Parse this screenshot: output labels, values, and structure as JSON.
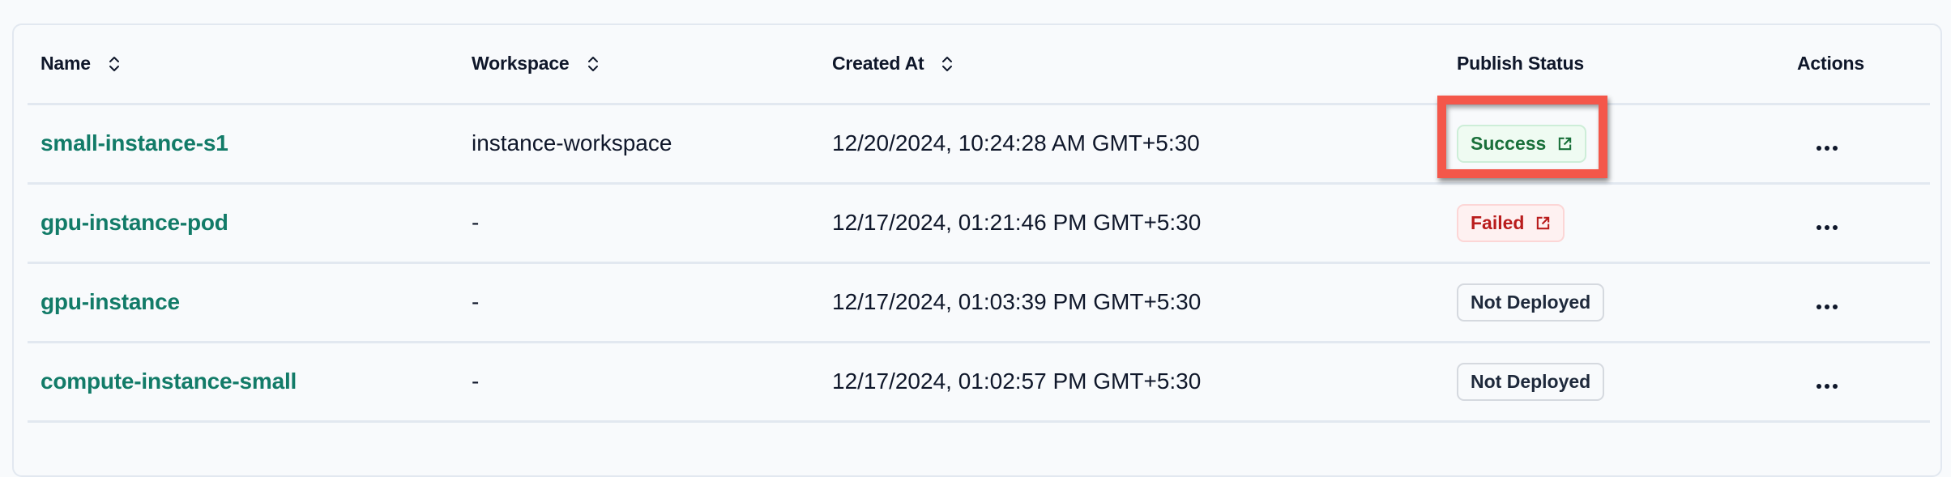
{
  "table": {
    "columns": [
      {
        "label": "Name",
        "sortable": true,
        "sort_icon": "sort-updown-icon"
      },
      {
        "label": "Workspace",
        "sortable": true,
        "sort_icon": "sort-updown-icon"
      },
      {
        "label": "Created At",
        "sortable": true,
        "sort_icon": "sort-updown-icon"
      },
      {
        "label": "Publish Status",
        "sortable": false
      },
      {
        "label": "Actions",
        "sortable": false
      }
    ],
    "rows": [
      {
        "name": "small-instance-s1",
        "workspace": "instance-workspace",
        "created_at": "12/20/2024, 10:24:28 AM GMT+5:30",
        "status": "Success",
        "status_type": "success",
        "status_icon": "external-link-icon",
        "actions_icon": "more-horizontal-icon"
      },
      {
        "name": "gpu-instance-pod",
        "workspace": "-",
        "created_at": "12/17/2024, 01:21:46 PM GMT+5:30",
        "status": "Failed",
        "status_type": "failed",
        "status_icon": "external-link-icon",
        "actions_icon": "more-horizontal-icon"
      },
      {
        "name": "gpu-instance",
        "workspace": "-",
        "created_at": "12/17/2024, 01:03:39 PM GMT+5:30",
        "status": "Not Deployed",
        "status_type": "neutral",
        "actions_icon": "more-horizontal-icon"
      },
      {
        "name": "compute-instance-small",
        "workspace": "-",
        "created_at": "12/17/2024, 01:02:57 PM GMT+5:30",
        "status": "Not Deployed",
        "status_type": "neutral",
        "actions_icon": "more-horizontal-icon"
      }
    ]
  },
  "highlight": {
    "target": "row-0-publish-status",
    "color": "#f4574a"
  },
  "colors": {
    "link": "#127b68",
    "success": "#19703a",
    "failed": "#b91c1c",
    "neutral": "#1e293b",
    "border": "#e2e8f0",
    "background": "#f8fafc"
  }
}
